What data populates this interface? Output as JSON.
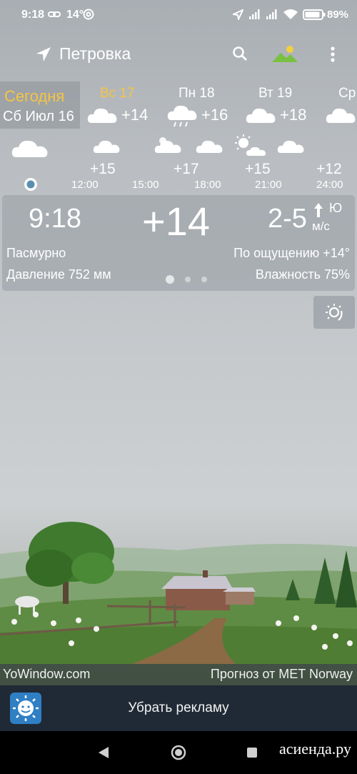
{
  "status_bar": {
    "time": "9:18",
    "temp": "14°",
    "battery": "89%"
  },
  "header": {
    "location": "Петровка",
    "icons": [
      "location-arrow-icon",
      "search-icon",
      "landscape-icon",
      "more-vert-icon"
    ]
  },
  "days": {
    "today_label": "Сегодня",
    "today_date": "Сб Июл 16",
    "items": [
      {
        "name": "Вс 17",
        "temp": "+14"
      },
      {
        "name": "Пн 18",
        "temp": "+16"
      },
      {
        "name": "Вт 19",
        "temp": "+18"
      },
      {
        "name": "Ср",
        "temp": ""
      }
    ]
  },
  "hourly": [
    {
      "temp": "+15",
      "time": "12:00"
    },
    {
      "temp": "",
      "time": "15:00"
    },
    {
      "temp": "+17",
      "time": "18:00"
    },
    {
      "temp": "+15",
      "time": "21:00"
    },
    {
      "temp": "+12",
      "time": "24:00"
    }
  ],
  "current": {
    "time": "9:18",
    "temp": "+14",
    "wind": "2-5",
    "wind_dir": "Ю",
    "wind_unit": "м/с",
    "condition": "Пасмурно",
    "feels_like": "По ощущению +14°",
    "pressure": "Давление 752 мм",
    "humidity": "Влажность 75%"
  },
  "footer": {
    "site": "YoWindow.com",
    "forecast_source": "Прогноз от MET Norway",
    "ad_label": "Убрать рекламу"
  },
  "watermark": "асиенда.ру",
  "colors": {
    "accent_today": "#f4c542",
    "ad_bar": "#1f2a36"
  }
}
